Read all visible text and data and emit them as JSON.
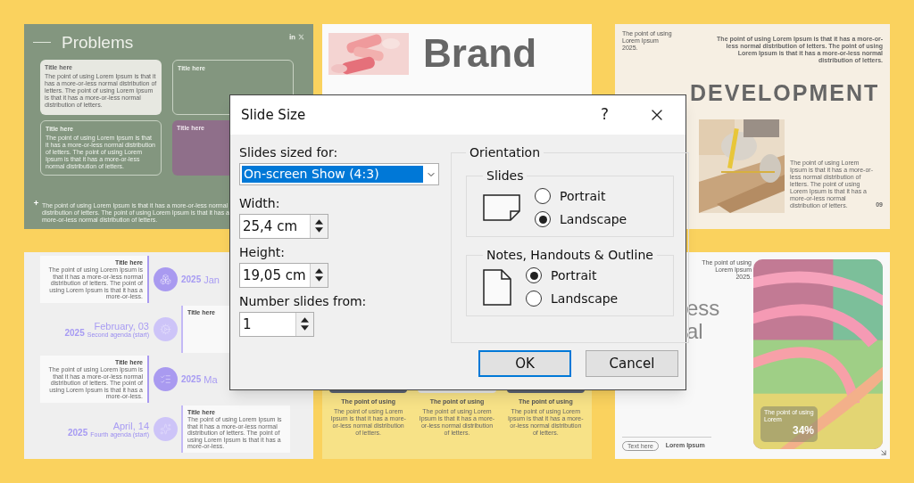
{
  "problems_slide": {
    "title": "Problems",
    "cards": [
      {
        "kind": "light",
        "title": "Title here",
        "body": "The point of using Lorem Ipsum is that it has a more-or-less normal distribution of letters. The point of using Lorem Ipsum is that it has a more-or-less normal distribution of letters."
      },
      {
        "kind": "outline",
        "title": "Title here"
      },
      {
        "kind": "outline",
        "title": "Title here",
        "body": "The point of using Lorem Ipsum is that it has a more-or-less normal distribution of letters. The point of using Lorem Ipsum is that it has a more-or-less normal distribution of letters."
      },
      {
        "kind": "purple",
        "title": "Title here"
      }
    ],
    "note": "The point of using Lorem Ipsum is that it has a more-or-less normal distribution of letters. The point of using Lorem Ipsum is that it has a more-or-less normal distribution of letters."
  },
  "timeline_slide": {
    "rows": [
      {
        "kind": "card-left",
        "card": {
          "title": "Title here",
          "body": "The point of using Lorem Ipsum is that it has a more-or-less normal distribution of letters. The point of using Lorem Ipsum is that it has a more-or-less."
        },
        "year": "2025",
        "date": "Jan"
      },
      {
        "kind": "card-right",
        "year": "2025",
        "date": "February, 03",
        "caption": "Second agenda (start)",
        "card": {
          "title": "Title here"
        }
      },
      {
        "kind": "card-left",
        "card": {
          "title": "Title here",
          "body": "The point of using Lorem Ipsum is that it has a more-or-less normal distribution of letters. The point of using Lorem Ipsum is that it has a more-or-less."
        },
        "year": "2025",
        "date": "Ma"
      },
      {
        "kind": "card-right",
        "year": "2025",
        "date": "April, 14",
        "caption": "Fourth agenda (start)",
        "card": {
          "title": "Title here",
          "body": "The point of using Lorem Ipsum is that it has a more-or-less normal distribution of letters. The point of using Lorem Ipsum is that it has a more-or-less."
        }
      }
    ]
  },
  "brand_slide": {
    "title": "Brand",
    "columns": [
      {
        "title": "The point of using",
        "body": "The point of using Lorem Ipsum is that it has a more-or-less normal distribution of letters."
      },
      {
        "title": "The point of using",
        "body": "The point of using Lorem Ipsum is that it has a more-or-less normal distribution of letters."
      },
      {
        "title": "The point of using",
        "body": "The point of using Lorem Ipsum is that it has a more-or-less normal distribution of letters."
      }
    ]
  },
  "development_slide": {
    "caption_lines": [
      "The point of using",
      "Lorem Ipsum",
      "2025."
    ],
    "intro": "The point of using Lorem Ipsum is that it has a more-or-less normal distribution of letters. The point of using Lorem Ipsum is that it has a more-or-less normal distribution of letters.",
    "title": "DEVELOPMENT",
    "body": "The point of using Lorem Ipsum is that it has a more-or-less normal distribution of letters. The point of using Lorem Ipsum is that it has a more-or-less normal distribution of letters.",
    "page": "09"
  },
  "progress_slide": {
    "caption_lines": [
      "The point of using",
      "Lorem Ipsum",
      "2025."
    ],
    "heading_lines": [
      "ess",
      "al"
    ],
    "stat": {
      "label": "The point of using Lorem",
      "value": "34%"
    },
    "tag": "Text here",
    "footer": "Lorem Ipsum"
  },
  "dialog": {
    "title": "Slide Size",
    "help": "?",
    "size_label": "Slides sized for:",
    "size_value": "On-screen Show (4:3)",
    "width_label": "Width:",
    "width_value": "25,4 cm",
    "height_label": "Height:",
    "height_value": "19,05 cm",
    "number_label": "Number slides from:",
    "number_value": "1",
    "orientation_label": "Orientation",
    "groups": [
      {
        "label": "Slides",
        "kind": "landscape",
        "options": [
          {
            "label": "Portrait",
            "selected": false
          },
          {
            "label": "Landscape",
            "selected": true
          }
        ]
      },
      {
        "label": "Notes, Handouts & Outline",
        "kind": "portrait",
        "options": [
          {
            "label": "Portrait",
            "selected": true
          },
          {
            "label": "Landscape",
            "selected": false
          }
        ]
      }
    ],
    "buttons": [
      {
        "label": "OK",
        "default": true
      },
      {
        "label": "Cancel",
        "default": false
      }
    ]
  }
}
